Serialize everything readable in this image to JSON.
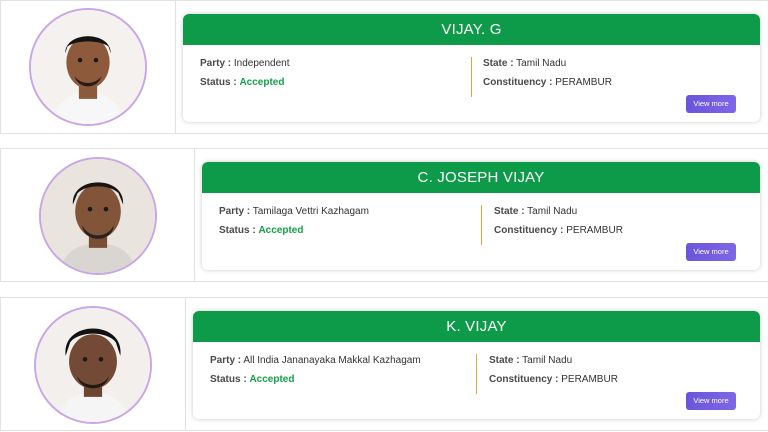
{
  "candidates": [
    {
      "name": "VIJAY. G",
      "party_label": "Party :",
      "party": "Independent",
      "status_label": "Status :",
      "status": "Accepted",
      "state_label": "State :",
      "state": "Tamil Nadu",
      "constituency_label": "Constituency :",
      "constituency": "PERAMBUR",
      "button": "View more"
    },
    {
      "name": "C. JOSEPH VIJAY",
      "party_label": "Party :",
      "party": "Tamilaga Vettri Kazhagam",
      "status_label": "Status :",
      "status": "Accepted",
      "state_label": "State :",
      "state": "Tamil Nadu",
      "constituency_label": "Constituency :",
      "constituency": "PERAMBUR",
      "button": "View more"
    },
    {
      "name": "K. VIJAY",
      "party_label": "Party :",
      "party": "All India Jananayaka Makkal Kazhagam",
      "status_label": "Status :",
      "status": "Accepted",
      "state_label": "State :",
      "state": "Tamil Nadu",
      "constituency_label": "Constituency :",
      "constituency": "PERAMBUR",
      "button": "View more"
    }
  ],
  "colors": {
    "header_green": "#0e9b49",
    "accepted_green": "#14a04a",
    "button_purple": "#6a55d8",
    "avatar_ring": "#c9a6e6",
    "divider_gold": "#d8a64a"
  }
}
